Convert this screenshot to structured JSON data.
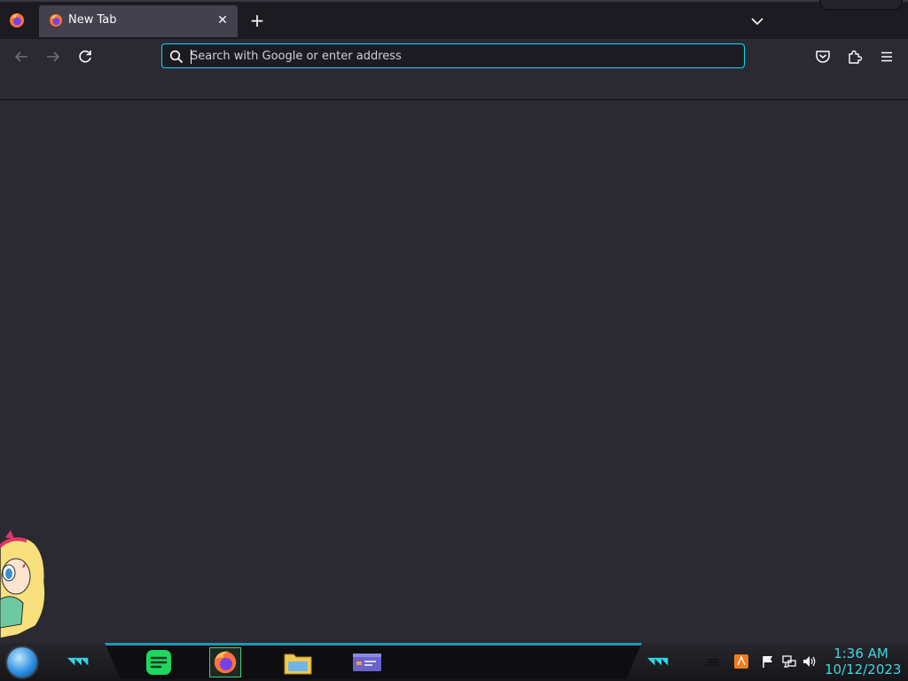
{
  "browser": {
    "tab": {
      "title": "New Tab",
      "close_glyph": "✕"
    },
    "new_tab_glyph": "+",
    "url_bar": {
      "placeholder": "Search with Google or enter address",
      "value": ""
    },
    "icons": {
      "app_menu": "firefox-icon",
      "back": "back-arrow-icon",
      "forward": "forward-arrow-icon",
      "reload": "reload-icon",
      "search": "search-icon",
      "list_all_tabs": "chevron-down-icon",
      "pocket": "pocket-icon",
      "extensions": "extensions-icon",
      "menu": "hamburger-menu-icon"
    },
    "colors": {
      "accent": "#00ddff",
      "toolbar": "#2b2a33",
      "tabstrip": "#1c1b22",
      "tab_selected": "#42414d"
    }
  },
  "taskbar": {
    "apps": [
      "spotify-icon",
      "firefox-icon",
      "file-explorer-icon",
      "window-icon"
    ],
    "tray": [
      "bars-icon",
      "java-update-icon",
      "flag-icon",
      "network-icon",
      "volume-icon"
    ],
    "clock": {
      "time": "1:36 AM",
      "date": "10/12/2023"
    },
    "colors": {
      "accent": "#2fd6e8"
    }
  }
}
